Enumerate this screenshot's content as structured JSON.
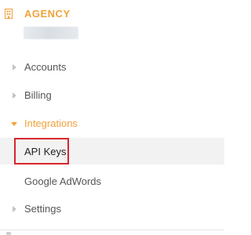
{
  "sidebar": {
    "section": {
      "icon": "building-icon",
      "title": "AGENCY"
    },
    "items": [
      {
        "label": "Accounts",
        "icon": "chevron-right-icon"
      },
      {
        "label": "Billing",
        "icon": "chevron-right-icon"
      },
      {
        "label": "Integrations",
        "icon": "chevron-down-icon",
        "expanded": true,
        "children": [
          {
            "label": "API Keys",
            "selected": true
          },
          {
            "label": "Google AdWords"
          }
        ]
      },
      {
        "label": "Settings",
        "icon": "chevron-right-icon"
      }
    ]
  },
  "colors": {
    "accent": "#f0a23a",
    "text": "#555555",
    "selected_bg": "#f2f2f2",
    "highlight_border": "#d8262e"
  }
}
